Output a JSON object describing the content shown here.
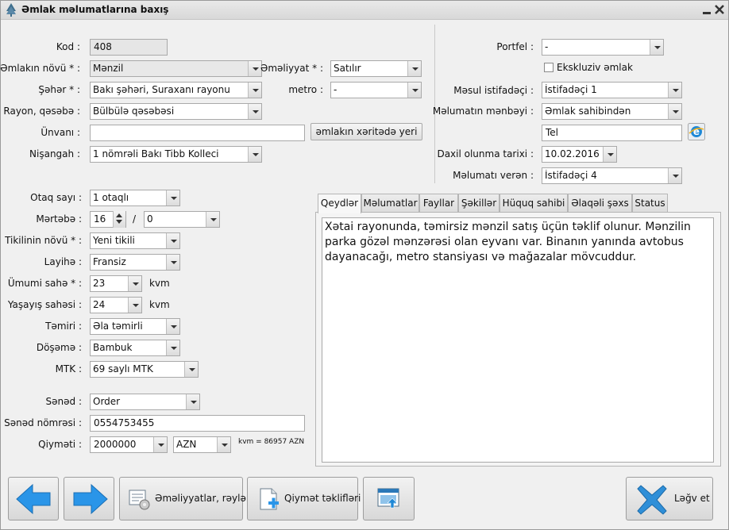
{
  "window": {
    "title": "Əmlak məlumatlarına baxış",
    "minimize_icon": "minimize-icon",
    "close_icon": "close-icon"
  },
  "left": {
    "kod_label": "Kod :",
    "kod_value": "408",
    "emlak_novu_label": "Əmlakın növü * :",
    "emlak_novu_value": "Mənzil",
    "emeliyyat_label": "Əməliyyat * :",
    "emeliyyat_value": "Satılır",
    "seher_label": "Şəhər * :",
    "seher_value": "Bakı şəhəri, Suraxanı rayonu",
    "metro_label": "metro :",
    "metro_value": "-",
    "rayon_label": "Rayon, qəsəbə :",
    "rayon_value": "Bülbülə qəsəbəsi",
    "unvan_label": "Ünvanı :",
    "unvan_value": "",
    "map_button": "əmlakın xəritədə yeri",
    "nisangah_label": "Nişangah :",
    "nisangah_value": "1 nömrəli Bakı Tibb Kolleci"
  },
  "right": {
    "portfel_label": "Portfel :",
    "portfel_value": "-",
    "exclusive_label": "Ekskluziv əmlak",
    "exclusive_checked": false,
    "mesul_label": "Məsul istifadəçi :",
    "mesul_value": "İstifadəçi 1",
    "menbe_label": "Məlumatın mənbəyi :",
    "menbe_value": "Əmlak sahibindən",
    "tel_value": "Tel",
    "daxil_label": "Daxil olunma tarixi :",
    "daxil_value": "10.02.2016",
    "veren_label": "Məlumatı verən :",
    "veren_value": "İstifadəçi 4"
  },
  "details": {
    "otaq_label": "Otaq sayı :",
    "otaq_value": "1 otaqlı",
    "mertebe_label": "Mərtəbə :",
    "mertebe_value": "16",
    "mertebe_sep": "/",
    "mertebe_total": "0",
    "tikili_label": "Tikilinin növü * :",
    "tikili_value": "Yeni tikili",
    "layihe_label": "Layihə :",
    "layihe_value": "Fransiz",
    "umumi_label": "Ümumi sahə * :",
    "umumi_value": "23",
    "umumi_unit": "kvm",
    "yasayis_label": "Yaşayış sahəsi :",
    "yasayis_value": "24",
    "yasayis_unit": "kvm",
    "temir_label": "Təmiri :",
    "temir_value": "Əla təmirli",
    "doseme_label": "Döşəmə :",
    "doseme_value": "Bambuk",
    "mtk_label": "MTK :",
    "mtk_value": "69 saylı MTK",
    "sened_label": "Sənəd :",
    "sened_value": "Order",
    "sened_nomre_label": "Sənəd nömrəsi :",
    "sened_nomre_value": "0554753455",
    "qiymet_label": "Qiyməti :",
    "qiymet_value": "2000000",
    "currency_value": "AZN",
    "kvm_price": "kvm = 86957 AZN"
  },
  "tabs": [
    "Qeydlər",
    "Məlumatlar",
    "Fayllar",
    "Şəkillər",
    "Hüquq sahibi",
    "Əlaqəli şəxs",
    "Status"
  ],
  "active_tab": 0,
  "notes_text": "Xətai rayonunda, təmirsiz mənzil satış üçün təklif olunur. Mənzilin parka gözəl mənzərəsi olan eyvanı var. Binanın yanında avtobus dayanacağı, metro stansiyası və mağazalar mövcuddur.",
  "buttons": {
    "prev_icon": "arrow-left-icon",
    "next_icon": "arrow-right-icon",
    "operations_label": "Əməliyyatlar, rəylər",
    "price_offers_label": "Qiymət təklifləri",
    "cancel_label": "Ləğv et"
  },
  "colors": {
    "accent_blue": "#1e90ff",
    "cancel_blue": "#2f8fd8"
  }
}
